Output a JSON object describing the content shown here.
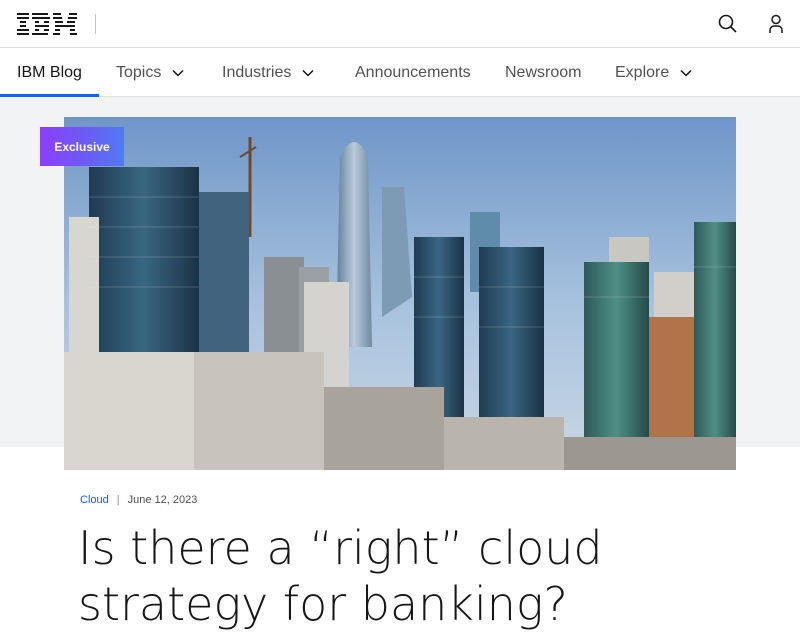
{
  "masthead": {
    "logo_text": "IBM",
    "icons": [
      "search-icon",
      "user-icon"
    ]
  },
  "nav": {
    "items": [
      {
        "label": "IBM Blog",
        "active": true,
        "dropdown": false
      },
      {
        "label": "Topics",
        "active": false,
        "dropdown": true
      },
      {
        "label": "Industries",
        "active": false,
        "dropdown": true
      },
      {
        "label": "Announcements",
        "active": false,
        "dropdown": false
      },
      {
        "label": "Newsroom",
        "active": false,
        "dropdown": false
      },
      {
        "label": "Explore",
        "active": false,
        "dropdown": true
      }
    ]
  },
  "hero": {
    "badge": "Exclusive",
    "image_subject": "city skyline"
  },
  "article": {
    "category": "Cloud",
    "separator": "|",
    "date": "June 12, 2023",
    "title": "Is there a “right” cloud strategy for banking?"
  },
  "colors": {
    "accent": "#0f62fe",
    "badge_start": "#8a3ffc",
    "badge_end": "#4f7bf4",
    "band": "#f2f3f5"
  }
}
